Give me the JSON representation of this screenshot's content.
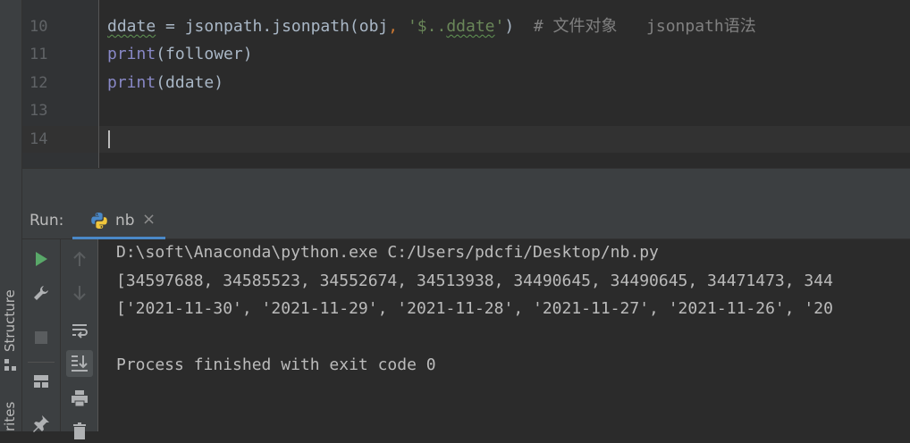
{
  "side_tabs": {
    "structure": "Structure",
    "favorites": "rites"
  },
  "editor": {
    "line_numbers": [
      "10",
      "11",
      "12",
      "13",
      "14"
    ],
    "code": {
      "l10_var": "ddate",
      "l10_eq": " = jsonpath.jsonpath(obj",
      "l10_comma": ",",
      "l10_str_open": " '$..",
      "l10_str_word": "ddate",
      "l10_str_close": "'",
      "l10_paren": ")",
      "l10_comment": "  # 文件对象   jsonpath语法",
      "l11_fn": "print",
      "l11_args": "(follower)",
      "l12_fn": "print",
      "l12_args": "(ddate)"
    }
  },
  "run_panel": {
    "label": "Run:",
    "tab": {
      "name": "nb",
      "close": "×",
      "icon": "python-icon"
    },
    "console_lines": [
      "D:\\soft\\Anaconda\\python.exe C:/Users/pdcfi/Desktop/nb.py",
      "[34597688, 34585523, 34552674, 34513938, 34490645, 34490645, 34471473, 344",
      "['2021-11-30', '2021-11-29', '2021-11-28', '2021-11-27', '2021-11-26', '20",
      "",
      "Process finished with exit code 0"
    ],
    "toolbar_icons": [
      "run-icon",
      "wrench-icon",
      "stop-icon",
      "layout-icon",
      "pin-icon",
      "up-arrow-icon",
      "down-arrow-icon",
      "soft-wrap-icon",
      "scroll-to-end-icon",
      "print-icon",
      "trash-icon"
    ]
  },
  "colors": {
    "editor_bg": "#2b2b2b",
    "panel_bg": "#3c3f41",
    "keyword_builtin": "#8888c6",
    "string": "#6a8759",
    "comment": "#808080",
    "accent": "#4a88c7"
  }
}
